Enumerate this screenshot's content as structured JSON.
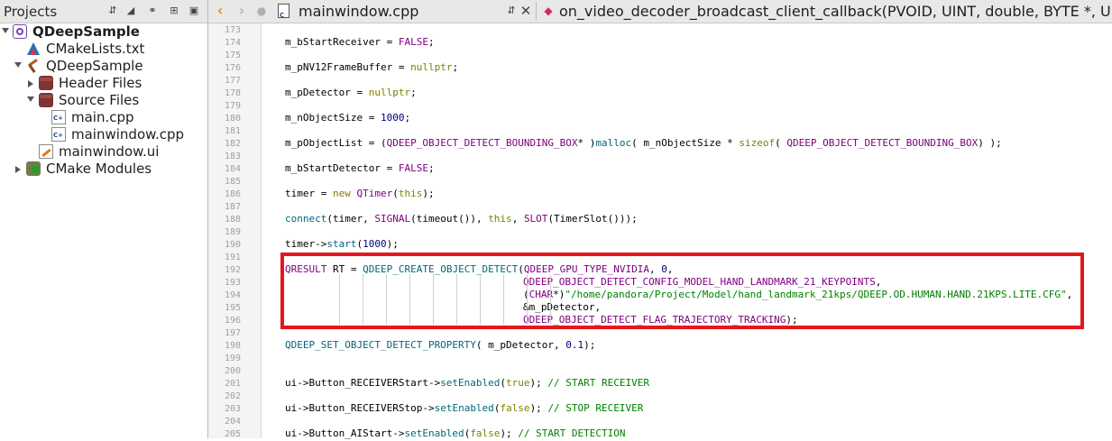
{
  "projects_panel": {
    "title": "Projects",
    "tree": [
      {
        "label": "QDeepSample",
        "icon": "project-icon",
        "bold": true,
        "expanded": true
      },
      {
        "label": "CMakeLists.txt",
        "icon": "cmake-file-icon"
      },
      {
        "label": "QDeepSample",
        "icon": "build-target-icon",
        "expanded": true
      },
      {
        "label": "Header Files",
        "icon": "folder-icon",
        "expanded": false
      },
      {
        "label": "Source Files",
        "icon": "folder-icon",
        "expanded": true
      },
      {
        "label": "main.cpp",
        "icon": "cpp-file-icon"
      },
      {
        "label": "mainwindow.cpp",
        "icon": "cpp-file-icon"
      },
      {
        "label": "mainwindow.ui",
        "icon": "ui-file-icon"
      },
      {
        "label": "CMake Modules",
        "icon": "cmake-modules-icon",
        "expanded": false
      }
    ]
  },
  "editor": {
    "file_name": "mainwindow.cpp",
    "function": "on_video_decoder_broadcast_client_callback(PVOID, UINT, double, BYTE *, ULONG, PVOID",
    "line_numbers": [
      "173",
      "174",
      "175",
      "176",
      "177",
      "178",
      "179",
      "180",
      "181",
      "182",
      "183",
      "184",
      "185",
      "186",
      "187",
      "188",
      "189",
      "190",
      "191",
      "192",
      "193",
      "194",
      "195",
      "196",
      "197",
      "198",
      "199",
      "200",
      "201",
      "202",
      "203",
      "204",
      "205"
    ],
    "code": [
      {
        "text": "m_bStartReceiver = FALSE;"
      },
      {
        "text": "m_pNV12FrameBuffer = nullptr;"
      },
      {
        "text": "m_pDetector = nullptr;"
      },
      {
        "text": "m_nObjectSize = 1000;"
      },
      {
        "text": "m_pObjectList = (QDEEP_OBJECT_DETECT_BOUNDING_BOX* )malloc( m_nObjectSize * sizeof( QDEEP_OBJECT_DETECT_BOUNDING_BOX) );"
      },
      {
        "text": "m_bStartDetector = FALSE;"
      },
      {
        "text": "timer = new QTimer(this);"
      },
      {
        "text": "connect(timer, SIGNAL(timeout()), this, SLOT(TimerSlot()));"
      },
      {
        "text": "timer->start(1000);"
      },
      {
        "text": "QRESULT RT = QDEEP_CREATE_OBJECT_DETECT(QDEEP_GPU_TYPE_NVIDIA, 0,"
      },
      {
        "text": "QDEEP_OBJECT_DETECT_CONFIG_MODEL_HAND_LANDMARK_21_KEYPOINTS,"
      },
      {
        "text": "(CHAR*)\"/home/pandora/Project/Model/hand_landmark_21kps/QDEEP.OD.HUMAN.HAND.21KPS.LITE.CFG\","
      },
      {
        "text": "&m_pDetector,"
      },
      {
        "text": "QDEEP_OBJECT_DETECT_FLAG_TRAJECTORY_TRACKING);"
      },
      {
        "text": "QDEEP_SET_OBJECT_DETECT_PROPERTY( m_pDetector, 0.1);"
      },
      {
        "text": "ui->Button_RECEIVERStart->setEnabled(true); // START RECEIVER"
      },
      {
        "text": "ui->Button_RECEIVERStop->setEnabled(false); // STOP RECEIVER"
      },
      {
        "text": "ui->Button_AIStart->setEnabled(false); // START DETECTION"
      }
    ]
  },
  "colors": {
    "highlight_box": "#e3171d",
    "keyword": "#808000",
    "type_macro": "#800080",
    "function": "#00677c",
    "number": "#000080",
    "string_comment": "#008000"
  }
}
